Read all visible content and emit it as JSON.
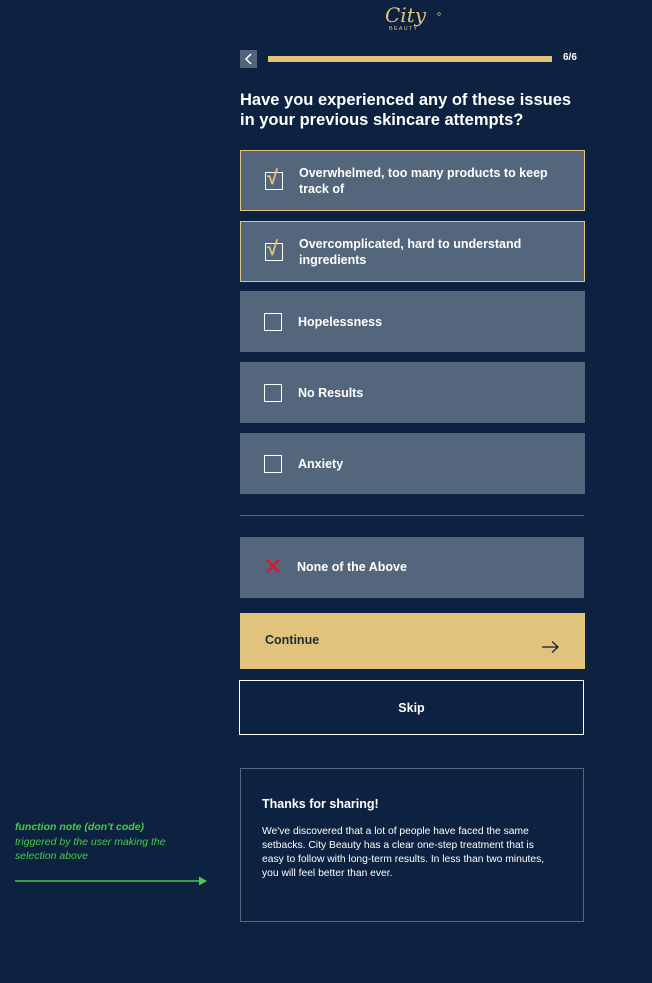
{
  "brand": {
    "logo_script": "City",
    "logo_sub": "BEAUTY",
    "accent": "#e2c37b"
  },
  "progress": {
    "count": "6/6",
    "fraction": 1.0
  },
  "question": "Have you experienced any of these issues in your previous skincare attempts?",
  "options": [
    {
      "label": "Overwhelmed, too many products to keep track of",
      "checked": true
    },
    {
      "label": "Overcomplicated, hard to understand ingredients",
      "checked": true
    },
    {
      "label": "Hopelessness",
      "checked": false
    },
    {
      "label": "No Results",
      "checked": false
    },
    {
      "label": "Anxiety",
      "checked": false
    }
  ],
  "checkmark_glyph": "√",
  "none_option": {
    "label": "None of the Above",
    "icon": "x-icon",
    "icon_color": "#e0162b"
  },
  "continue_label": "Continue",
  "skip_label": "Skip",
  "thanks": {
    "title": "Thanks for sharing!",
    "body": "We've discovered that a lot of people have faced the same setbacks. City Beauty has a clear one-step treatment that is easy to follow with long-term results. In less than two minutes, you will feel better than ever."
  },
  "note": {
    "title": "function note (don't code)",
    "text": "triggered by the user making the selection above",
    "color": "#4cc84a"
  }
}
